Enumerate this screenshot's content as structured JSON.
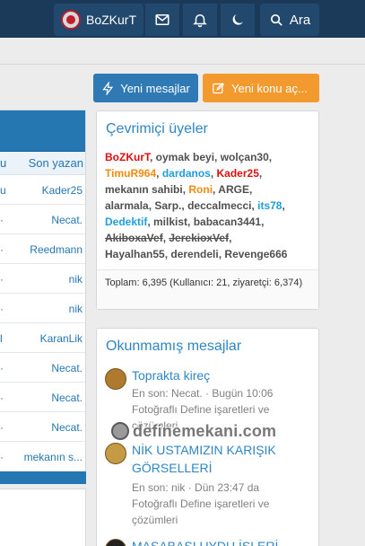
{
  "header": {
    "username": "BoZKurT",
    "search_label": "Ara",
    "icons": [
      "mail-icon",
      "bell-icon",
      "moon-icon",
      "search-icon"
    ]
  },
  "left_table": {
    "column_header": "Son yazan",
    "column_header_left": "u",
    "rows": [
      {
        "left": "u",
        "right": "Kader25"
      },
      {
        "left": "·",
        "right": "Necat."
      },
      {
        "left": "·",
        "right": "Reedmann"
      },
      {
        "left": "·",
        "right": "nik"
      },
      {
        "left": "·",
        "right": "nik"
      },
      {
        "left": "l",
        "right": "KaranLik"
      },
      {
        "left": "·",
        "right": "Necat."
      },
      {
        "left": "·",
        "right": "Necat."
      },
      {
        "left": "·",
        "right": "Necat."
      },
      {
        "left": "·",
        "right": "mekanın s..."
      }
    ]
  },
  "actions": {
    "new_messages": "Yeni mesajlar",
    "new_thread": "Yeni konu aç..."
  },
  "online_widget": {
    "title": "Çevrimiçi üyeler",
    "users": [
      {
        "name": "BoZKurT",
        "style": "red"
      },
      {
        "name": "oymak beyi",
        "style": "normal"
      },
      {
        "name": "wolçan30",
        "style": "normal"
      },
      {
        "name": "TimuR964",
        "style": "orange"
      },
      {
        "name": "dardanos",
        "style": "blue"
      },
      {
        "name": "Kader25",
        "style": "red"
      },
      {
        "name": "mekanın sahibi",
        "style": "normal"
      },
      {
        "name": "Roni",
        "style": "orange"
      },
      {
        "name": "ARGE",
        "style": "normal"
      },
      {
        "name": "alarmala",
        "style": "normal"
      },
      {
        "name": "Sarp.",
        "style": "normal"
      },
      {
        "name": "deccalmecci",
        "style": "normal"
      },
      {
        "name": "its78",
        "style": "blue"
      },
      {
        "name": "Dedektif",
        "style": "blue"
      },
      {
        "name": "milkist",
        "style": "normal"
      },
      {
        "name": "babacan3441",
        "style": "normal"
      },
      {
        "name": "AkiboxaVef",
        "style": "strike"
      },
      {
        "name": "JerekioxVef",
        "style": "strike"
      },
      {
        "name": "Hayalhan55",
        "style": "normal"
      },
      {
        "name": "derendeli",
        "style": "normal"
      },
      {
        "name": "Revenge666",
        "style": "normal"
      }
    ],
    "footer": "Toplam: 6,395 (Kullanıcı: 21, ziyaretçi: 6,374)"
  },
  "unread_widget": {
    "title": "Okunmamış mesajlar",
    "items": [
      {
        "title": "Toprakta kireç",
        "meta": "En son: Necat. · Bugün 10:06",
        "forum": "Fotoğraflı Define işaretleri ve çözümleri"
      },
      {
        "title": "NİK USTAMIZIN KARIŞIK GÖRSELLERİ",
        "meta": "En son: nik · Dün 23:47 da",
        "forum": "Fotoğraflı Define işaretleri ve çözümleri"
      },
      {
        "title": "MASABAŞI UYDU İŞLERİ",
        "meta": "",
        "forum": ""
      }
    ]
  },
  "watermark": {
    "text": "definemekani.com"
  },
  "colors": {
    "header_bg": "#1b3a5a",
    "accent_blue": "#2f7ab5",
    "accent_orange": "#f39a2e",
    "link_blue": "#2f86c5",
    "user_red": "#dd0e0e",
    "user_orange": "#f48a0d",
    "user_lightblue": "#1e9de0"
  }
}
